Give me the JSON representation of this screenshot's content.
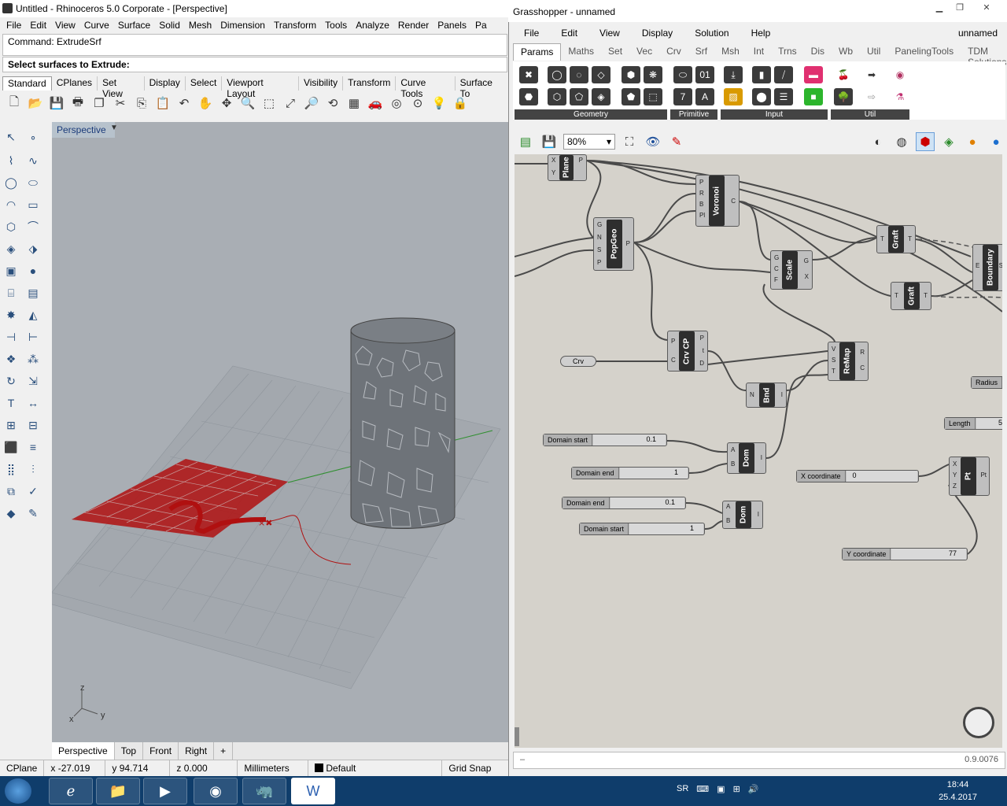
{
  "rhino": {
    "title": "Untitled - Rhinoceros  5.0 Corporate - [Perspective]",
    "menu": [
      "File",
      "Edit",
      "View",
      "Curve",
      "Surface",
      "Solid",
      "Mesh",
      "Dimension",
      "Transform",
      "Tools",
      "Analyze",
      "Render",
      "Panels",
      "Pa"
    ],
    "command_history": "Command: ExtrudeSrf",
    "command_prompt": "Select surfaces to Extrude:",
    "toolbar_tabs": [
      "Standard",
      "CPlanes",
      "Set View",
      "Display",
      "Select",
      "Viewport Layout",
      "Visibility",
      "Transform",
      "Curve Tools",
      "Surface To"
    ],
    "viewport_title": "Perspective",
    "viewport_tabs": [
      "Perspective",
      "Top",
      "Front",
      "Right",
      "+"
    ],
    "axis": {
      "z": "z",
      "x": "x",
      "y": "y"
    },
    "status": {
      "cplane": "CPlane",
      "x": "x -27.019",
      "y": "y 94.714",
      "z": "z 0.000",
      "units": "Millimeters",
      "layer": "Default",
      "snap": "Grid Snap"
    }
  },
  "grasshopper": {
    "title": "Grasshopper - unnamed",
    "menu": [
      "File",
      "Edit",
      "View",
      "Display",
      "Solution",
      "Help"
    ],
    "doc_name": "unnamed",
    "tabs": [
      "Params",
      "Maths",
      "Set",
      "Vec",
      "Crv",
      "Srf",
      "Msh",
      "Int",
      "Trns",
      "Dis",
      "Wb",
      "Util",
      "PanelingTools",
      "TDM Solutions"
    ],
    "ribbon_groups": [
      "Geometry",
      "Primitive",
      "Input",
      "Util"
    ],
    "zoom": "80%",
    "version": "0.9.0076",
    "components": {
      "plane": {
        "name": "Plane",
        "in": [
          "X",
          "Y"
        ],
        "out": [
          "P"
        ]
      },
      "voronoi": {
        "name": "Voronoi",
        "in": [
          "P",
          "R",
          "B",
          "Pl"
        ],
        "out": [
          "C"
        ]
      },
      "popgeo": {
        "name": "PopGeo",
        "in": [
          "G",
          "N",
          "S",
          "P"
        ],
        "out": [
          "P"
        ]
      },
      "scale": {
        "name": "Scale",
        "in": [
          "G",
          "C",
          "F"
        ],
        "out": [
          "G",
          "X"
        ]
      },
      "graft1": {
        "name": "Graft",
        "in": [
          "T"
        ],
        "out": [
          "T"
        ]
      },
      "graft2": {
        "name": "Graft",
        "in": [
          "T"
        ],
        "out": [
          "T"
        ]
      },
      "boundary": {
        "name": "Boundary",
        "in": [
          "E"
        ],
        "out": [
          "S"
        ]
      },
      "crvcp": {
        "name": "Crv CP",
        "in": [
          "P",
          "C"
        ],
        "out": [
          "P",
          "t",
          "D"
        ]
      },
      "remap": {
        "name": "ReMap",
        "in": [
          "V",
          "S",
          "T"
        ],
        "out": [
          "R",
          "C"
        ]
      },
      "bnd": {
        "name": "Bnd",
        "in": [
          "N"
        ],
        "out": [
          "I"
        ]
      },
      "dom1": {
        "name": "Dom",
        "in": [
          "A",
          "B"
        ],
        "out": [
          "I"
        ]
      },
      "dom2": {
        "name": "Dom",
        "in": [
          "A",
          "B"
        ],
        "out": [
          "I"
        ]
      },
      "pt": {
        "name": "Pt",
        "in": [
          "X",
          "Y",
          "Z"
        ],
        "out": [
          "Pt"
        ]
      },
      "crv": {
        "name": "Crv"
      }
    },
    "sliders": {
      "domain_start1": {
        "label": "Domain start",
        "value": "0.1"
      },
      "domain_end1": {
        "label": "Domain end",
        "value": "1"
      },
      "domain_end2": {
        "label": "Domain end",
        "value": "0.1"
      },
      "domain_start2": {
        "label": "Domain start",
        "value": "1"
      },
      "x_coord": {
        "label": "X coordinate",
        "value": "0"
      },
      "y_coord": {
        "label": "Y coordinate",
        "value": "77"
      },
      "radius": {
        "label": "Radius",
        "value": ""
      },
      "length": {
        "label": "Length",
        "value": "5"
      }
    }
  },
  "taskbar": {
    "time": "18:44",
    "date": "25.4.2017",
    "lang": "SR"
  },
  "colors": {
    "gh_canvas": "#d5d2cb",
    "viewport": "#a9aeb4",
    "taskbar": "#0f3d6b",
    "red_geometry": "#b01010"
  }
}
